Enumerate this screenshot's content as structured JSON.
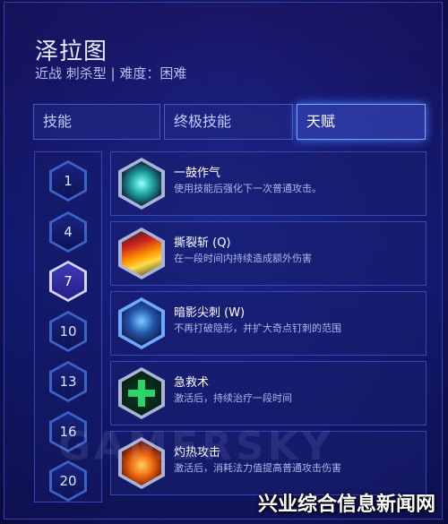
{
  "hero": {
    "name": "泽拉图",
    "subtitle": "近战 刺杀型 | 难度：困难"
  },
  "tabs": [
    {
      "label": "技能",
      "active": false
    },
    {
      "label": "终极技能",
      "active": false
    },
    {
      "label": "天赋",
      "active": true
    }
  ],
  "tiers": [
    {
      "level": "1",
      "active": false
    },
    {
      "level": "4",
      "active": false
    },
    {
      "level": "7",
      "active": true
    },
    {
      "level": "10",
      "active": false
    },
    {
      "level": "13",
      "active": false
    },
    {
      "level": "16",
      "active": false
    },
    {
      "level": "20",
      "active": false
    }
  ],
  "talents": [
    {
      "name": "一鼓作气",
      "desc": "使用技能后强化下一次普通攻击。",
      "icon": "power-core-icon"
    },
    {
      "name": "撕裂斩 (Q)",
      "desc": "在一段时间内持续造成额外伤害",
      "icon": "slash-icon"
    },
    {
      "name": "暗影尖刺 (W)",
      "desc": "不再打破隐形，并扩大奇点钉刺的范围",
      "icon": "shadow-spike-icon"
    },
    {
      "name": "急救术",
      "desc": "激活后，持续治疗一段时间",
      "icon": "heal-cross-icon"
    },
    {
      "name": "灼热攻击",
      "desc": "激活后，消耗法力值提高普通攻击伤害",
      "icon": "searing-attack-icon"
    }
  ],
  "watermark": "GAMERSKY",
  "site_mark": "兴业综合信息新闻网",
  "colors": {
    "accent": "#7fa8ff",
    "panel": "#1a2380",
    "heal": "#2bd36a"
  }
}
